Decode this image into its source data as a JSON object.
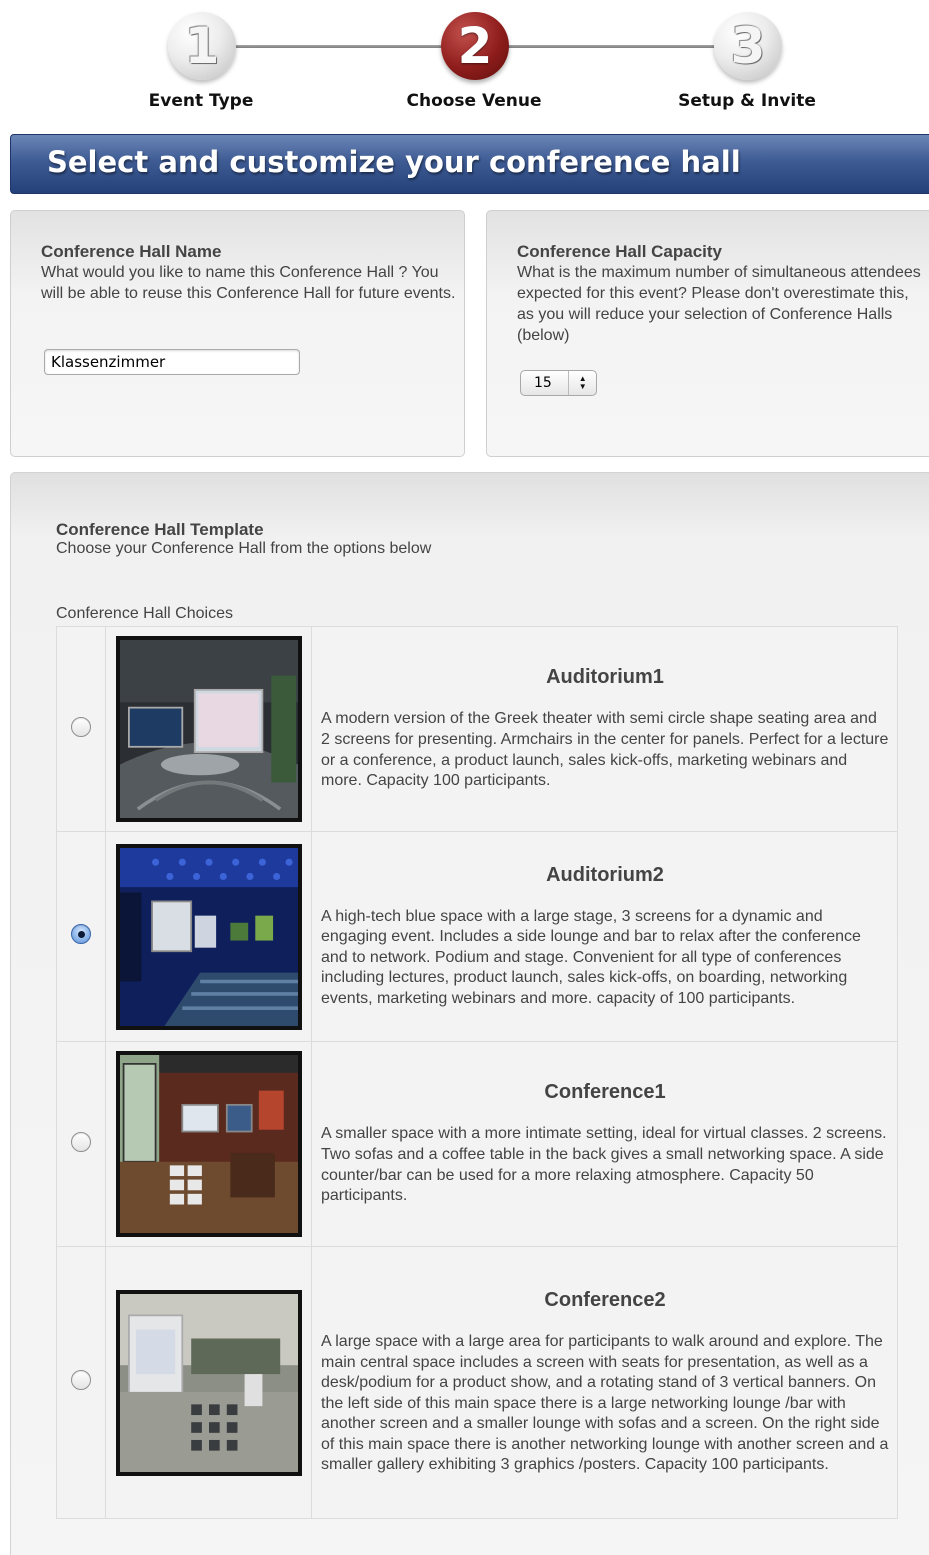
{
  "wizard": {
    "steps": [
      {
        "number": "1",
        "label": "Event Type"
      },
      {
        "number": "2",
        "label": "Choose Venue"
      },
      {
        "number": "3",
        "label": "Setup & Invite"
      }
    ]
  },
  "banner": {
    "title": "Select and customize your conference hall"
  },
  "hall_name": {
    "title": "Conference Hall Name",
    "description": "What would you like to name this Conference Hall ? You will be able to reuse this Conference Hall for future events.",
    "value": "Klassenzimmer"
  },
  "hall_capacity": {
    "title": "Conference Hall Capacity",
    "description": "What is the maximum number of simultaneous attendees expected for this event? Please don't overestimate this, as you will reduce your selection of Conference Halls (below)",
    "value": "15"
  },
  "template": {
    "title": "Conference Hall Template",
    "subtitle": "Choose your Conference Hall from the options below",
    "choices_label": "Conference Hall Choices",
    "choices": [
      {
        "name": "Auditorium1",
        "selected": false,
        "description": "A modern version of the Greek theater with semi circle shape seating area and 2 screens for presenting. Armchairs in the center for panels. Perfect for a lecture or a conference, a product launch, sales kick-offs, marketing webinars and more. Capacity 100 participants."
      },
      {
        "name": "Auditorium2",
        "selected": true,
        "description": "A high-tech blue space with a large stage, 3 screens for a dynamic and engaging event. Includes a side lounge and bar to relax after the conference and to network. Podium and stage. Convenient for all type of conferences including lectures, product launch, sales kick-offs, on boarding, networking events, marketing webinars and more. capacity of 100 participants."
      },
      {
        "name": "Conference1",
        "selected": false,
        "description": "A smaller space with a more intimate setting, ideal for virtual classes. 2 screens. Two sofas and a coffee table in the back gives a small networking space. A side counter/bar can be used for a more relaxing atmosphere. Capacity 50 participants."
      },
      {
        "name": "Conference2",
        "selected": false,
        "description": "A large space with a large area for participants to walk around and explore. The main central space includes a screen with seats for presentation, as well as a desk/podium for a product show, and a rotating stand of 3 vertical banners. On the left side of this main space there is a large networking lounge /bar with another screen and a smaller lounge with sofas and a screen. On the right side of this main space there is another networking lounge with another screen and a smaller gallery exhibiting 3 graphics /posters. Capacity 100 participants."
      }
    ]
  }
}
